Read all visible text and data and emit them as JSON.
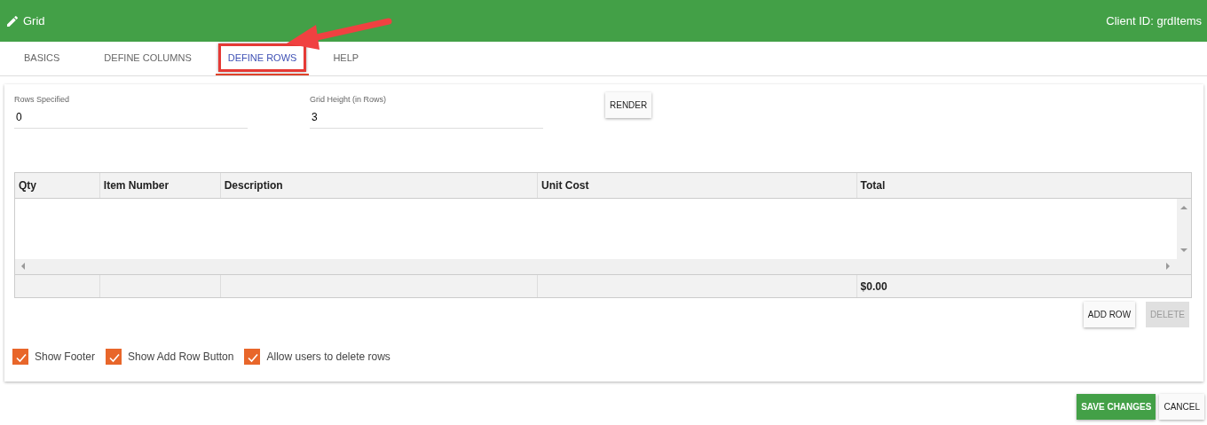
{
  "header": {
    "title": "Grid",
    "client_id": "Client ID: grdItems"
  },
  "tabs": [
    {
      "label": "BASICS",
      "selected": false,
      "highlighted": false
    },
    {
      "label": "DEFINE COLUMNS",
      "selected": false,
      "highlighted": false
    },
    {
      "label": "DEFINE ROWS",
      "selected": true,
      "highlighted": true
    },
    {
      "label": "HELP",
      "selected": false,
      "highlighted": false
    }
  ],
  "annotation": {
    "kind": "arrow"
  },
  "fields": [
    {
      "label": "Rows Specified",
      "value": "0"
    },
    {
      "label": "Grid Height (in Rows)",
      "value": "3"
    }
  ],
  "render_button": "RENDER",
  "table": {
    "columns": [
      "Qty",
      "Item Number",
      "Description",
      "Unit Cost",
      "Total"
    ],
    "footer_total": "$0.00"
  },
  "add_row_button": {
    "label": "ADD ROW",
    "disabled": false
  },
  "delete_button": {
    "label": "DELETE",
    "disabled": true
  },
  "options": [
    {
      "label": "Show Footer",
      "checked": true
    },
    {
      "label": "Show Add Row Button",
      "checked": true
    },
    {
      "label": "Allow users to delete rows",
      "checked": true
    }
  ],
  "save_button": "SAVE CHANGES",
  "cancel_button": "CANCEL"
}
